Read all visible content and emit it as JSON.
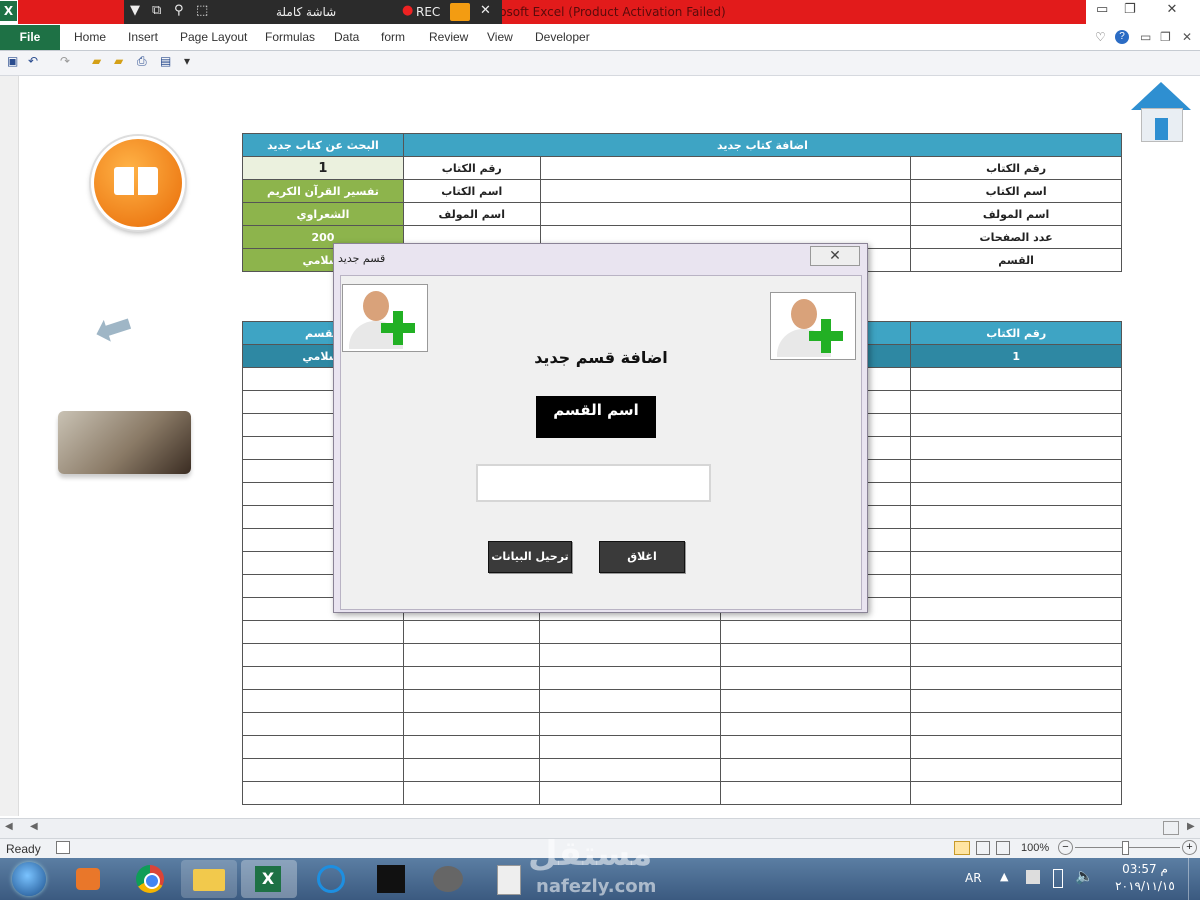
{
  "window": {
    "title": "Microsoft Excel (Product Activation Failed)",
    "app_letter": "X"
  },
  "recorder": {
    "mode_label": "شاشة كاملة",
    "rec_label": "REC"
  },
  "ribbon": {
    "file": "File",
    "tabs": [
      "Home",
      "Insert",
      "Page Layout",
      "Formulas",
      "Data",
      "form",
      "Review",
      "View",
      "Developer"
    ]
  },
  "form": {
    "add_header": "اضافة كتاب جديد",
    "search_header": "البحث عن كتاب جديد",
    "labels": [
      "رقم الكتاب",
      "اسم الكتاب",
      "اسم المولف",
      "عدد الصفحات",
      "القسم"
    ],
    "search_labels": [
      "رقم الكتاب",
      "اسم الكتاب",
      "اسم المولف"
    ],
    "search_values": [
      "1",
      "تفسير القرآن الكريم",
      "الشعراوي",
      "200",
      "اسلامي"
    ]
  },
  "list": {
    "col_book_no": "رقم الكتاب",
    "col_section": "القسم",
    "row1_no": "1",
    "row1_section": "اسلامي"
  },
  "dialog": {
    "title": "قسم جديد",
    "close": "✕",
    "heading": "اضافة قسم جديد",
    "field_label": "اسم القسم",
    "input_value": "",
    "submit_button": "ترحيل البيانات",
    "close_button": "اغلاق"
  },
  "status": {
    "ready": "Ready",
    "zoom": "100%"
  },
  "taskbar": {
    "lang": "AR",
    "time": "03:57 م",
    "date": "٢٠١٩/١١/١٥",
    "watermark_ar": "مستقل",
    "watermark_en": "nafezly.com"
  },
  "colors": {
    "title_red": "#e21b1b",
    "excel_green": "#1e7145",
    "header_blue": "#3ea4c4",
    "value_green": "#8db44c"
  }
}
